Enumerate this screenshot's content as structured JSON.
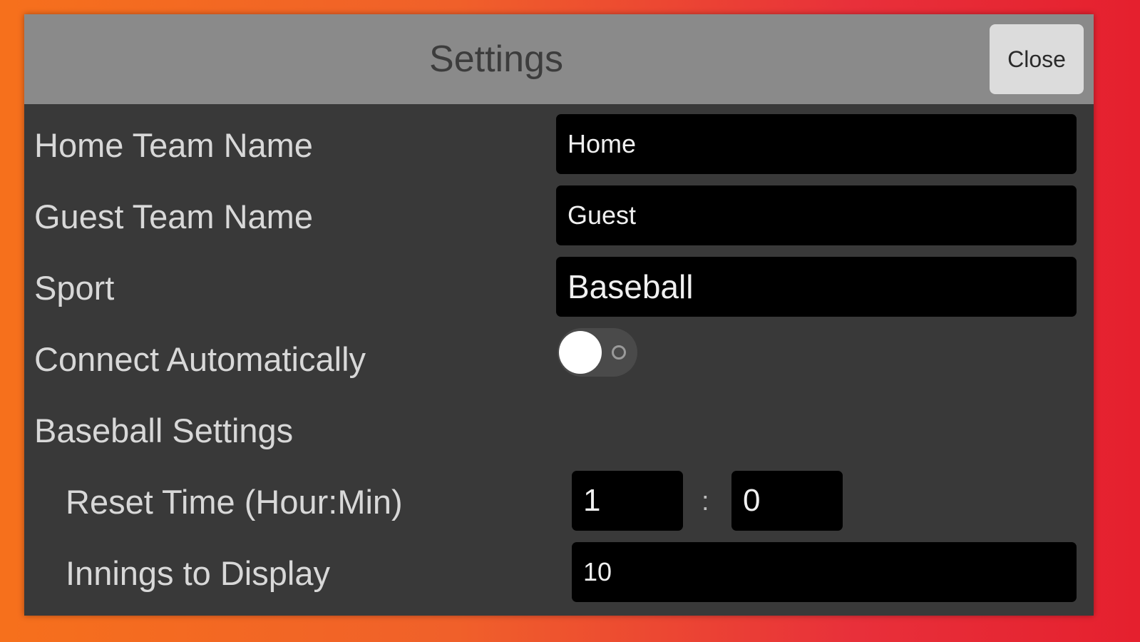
{
  "header": {
    "title": "Settings",
    "close_label": "Close"
  },
  "rows": {
    "home_team": {
      "label": "Home Team Name",
      "value": "Home"
    },
    "guest_team": {
      "label": "Guest Team Name",
      "value": "Guest"
    },
    "sport": {
      "label": "Sport",
      "value": "Baseball"
    },
    "connect": {
      "label": "Connect Automatically",
      "enabled": false
    },
    "baseball_section": {
      "label": "Baseball Settings"
    },
    "reset_time": {
      "label": "Reset Time (Hour:Min)",
      "hour": "1",
      "separator": ":",
      "minute": "0"
    },
    "innings": {
      "label": "Innings to Display",
      "value": "10"
    }
  },
  "colors": {
    "header_bg": "#8a8a8a",
    "panel_bg": "#393939",
    "field_bg": "#000000",
    "label_text": "#d8d8d8"
  }
}
